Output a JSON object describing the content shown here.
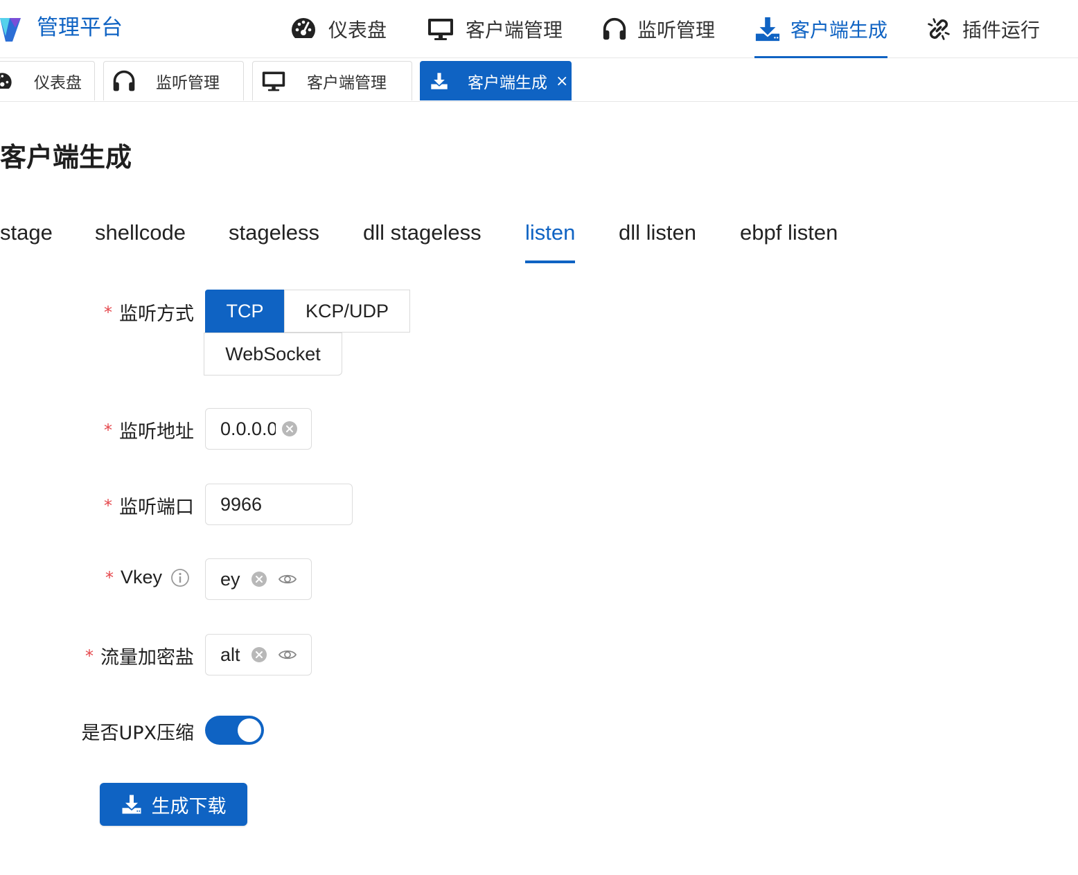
{
  "header": {
    "title": "管理平台",
    "menu": [
      {
        "label": "仪表盘",
        "icon": "dashboard-gauge-icon"
      },
      {
        "label": "客户端管理",
        "icon": "monitor-icon"
      },
      {
        "label": "监听管理",
        "icon": "headphones-icon"
      },
      {
        "label": "客户端生成",
        "icon": "download-icon",
        "active": true
      },
      {
        "label": "插件运行",
        "icon": "link-icon"
      }
    ]
  },
  "open_tabs": [
    {
      "label": "仪表盘",
      "icon": "dashboard-gauge-icon"
    },
    {
      "label": "监听管理",
      "icon": "headphones-icon"
    },
    {
      "label": "客户端管理",
      "icon": "monitor-icon"
    },
    {
      "label": "客户端生成",
      "icon": "download-icon",
      "active": true,
      "close": "×"
    }
  ],
  "page": {
    "title": "客户端生成",
    "subtabs": [
      "stage",
      "shellcode",
      "stageless",
      "dll stageless",
      "listen",
      "dll listen",
      "ebpf listen"
    ],
    "active_subtab": "listen"
  },
  "form": {
    "required_mark": "*",
    "listen_mode": {
      "label": "监听方式",
      "options": [
        "TCP",
        "KCP/UDP",
        "WebSocket"
      ],
      "selected": "TCP"
    },
    "listen_address": {
      "label": "监听地址",
      "value": "0.0.0.0"
    },
    "listen_port": {
      "label": "监听端口",
      "value": "9966"
    },
    "vkey": {
      "label": "Vkey",
      "value": "ey",
      "info_icon": "info-circle-icon"
    },
    "salt": {
      "label": "流量加密盐",
      "value": "alt"
    },
    "upx": {
      "label": "是否UPX压缩",
      "enabled": true
    },
    "submit_label": "生成下载"
  },
  "colors": {
    "primary": "#0f63c3",
    "required": "#e5484d",
    "border": "#dcdcdc"
  }
}
